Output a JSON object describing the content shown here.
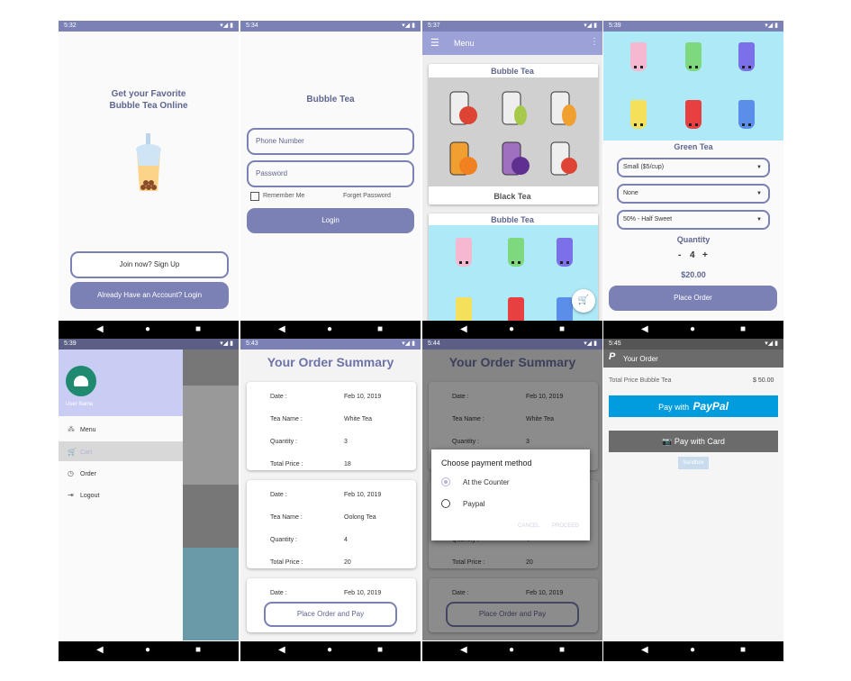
{
  "status_times": [
    "5:32",
    "5:34",
    "5:37",
    "5:39",
    "5:39",
    "5:43",
    "5:44",
    "5:45"
  ],
  "s1": {
    "headline1": "Get your Favorite",
    "headline2": "Bubble Tea Online",
    "signup": "Join now? Sign Up",
    "login": "Already Have an Account? Login"
  },
  "s2": {
    "title": "Bubble Tea",
    "phone_placeholder": "Phone Number",
    "password_placeholder": "Password",
    "remember": "Remember Me",
    "forget": "Forget Password",
    "login": "Login"
  },
  "s3": {
    "toolbar_title": "Menu",
    "card1_title": "Bubble Tea",
    "card1_caption": "Black Tea",
    "card2_title": "Bubble Tea"
  },
  "s4": {
    "product": "Green Tea",
    "size": "Small ($5/cup)",
    "topping": "None",
    "sweetness": "50% - Half Sweet",
    "quantity_label": "Quantity",
    "minus": "-",
    "qty": "4",
    "plus": "+",
    "price": "$20.00",
    "place": "Place Order"
  },
  "s5": {
    "user_name": "User Name",
    "items": [
      "Menu",
      "Cart",
      "Order",
      "Logout"
    ]
  },
  "order": {
    "title": "Your Order Summary",
    "labels": [
      "Date :",
      "Tea Name :",
      "Quantity :",
      "Total Price :"
    ],
    "cards": [
      [
        "Feb 10, 2019",
        "White Tea",
        "3",
        "18"
      ],
      [
        "Feb 10, 2019",
        "Oolong Tea",
        "4",
        "20"
      ],
      [
        "Feb 10, 2019"
      ]
    ],
    "place_pay": "Place Order and Pay"
  },
  "dialog": {
    "title": "Choose payment method",
    "opt1": "At the Counter",
    "opt2": "Paypal",
    "cancel": "CANCEL",
    "proceed": "PROCEED"
  },
  "s8": {
    "toolbar": "Your Order",
    "total_label": "Total Price Bubble Tea",
    "total_value": "$ 50.00",
    "pay_with": "Pay with",
    "paypal": "PayPal",
    "card": "Pay with Card",
    "sandbox": "Sandbox"
  },
  "colors": {
    "accent": "#7b80b5",
    "paypal_blue": "#009cde",
    "cyan_bg": "#aee9f8"
  }
}
